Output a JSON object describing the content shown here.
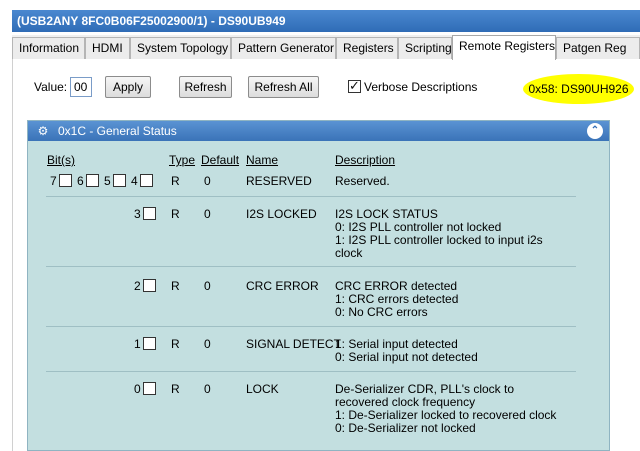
{
  "window": {
    "title": "(USB2ANY 8FC0B06F25002900/1) - DS90UB949"
  },
  "tabs": [
    {
      "label": "Information"
    },
    {
      "label": "HDMI"
    },
    {
      "label": "System Topology"
    },
    {
      "label": "Pattern Generator"
    },
    {
      "label": "Registers"
    },
    {
      "label": "Scripting"
    },
    {
      "label": "Remote Registers",
      "active": true
    },
    {
      "label": "Patgen Reg"
    }
  ],
  "toolbar": {
    "value_label": "Value:",
    "value": "00",
    "apply_label": "Apply",
    "refresh_label": "Refresh",
    "refresh_all_label": "Refresh All",
    "verbose_label": "Verbose Descriptions",
    "verbose_checked": true
  },
  "device_badge": {
    "text": "0x58: DS90UH926",
    "color": "#ffff00"
  },
  "panel": {
    "title": "0x1C - General Status",
    "headers": {
      "bits": "Bit(s)",
      "type": "Type",
      "default": "Default",
      "name": "Name",
      "description": "Description"
    },
    "rows": [
      {
        "bits": [
          "7",
          "6",
          "5",
          "4"
        ],
        "type": "R",
        "default": "0",
        "name": "RESERVED",
        "description": [
          "Reserved."
        ]
      },
      {
        "bits": [
          "3"
        ],
        "type": "R",
        "default": "0",
        "name": "I2S LOCKED",
        "description": [
          "I2S LOCK STATUS",
          "0: I2S PLL controller not locked",
          "1: I2S PLL controller locked to input i2s",
          "clock"
        ]
      },
      {
        "bits": [
          "2"
        ],
        "type": "R",
        "default": "0",
        "name": "CRC ERROR",
        "description": [
          "CRC ERROR detected",
          "1: CRC errors detected",
          "0: No CRC errors"
        ]
      },
      {
        "bits": [
          "1"
        ],
        "type": "R",
        "default": "0",
        "name": "SIGNAL DETECT",
        "description": [
          "1: Serial input detected",
          "0: Serial input not detected"
        ]
      },
      {
        "bits": [
          "0"
        ],
        "type": "R",
        "default": "0",
        "name": "LOCK",
        "description": [
          "De-Serializer CDR, PLL's clock to",
          "recovered clock frequency",
          "1: De-Serializer locked to recovered clock",
          "0: De-Serializer not locked"
        ]
      }
    ]
  },
  "colors": {
    "titlebar": "#2f6cb6",
    "panel_bg": "#c3dfe0",
    "panel_header": "#3a73b8"
  },
  "icons": {
    "panel": "gear-icon",
    "collapse": "chevron-up-icon"
  }
}
